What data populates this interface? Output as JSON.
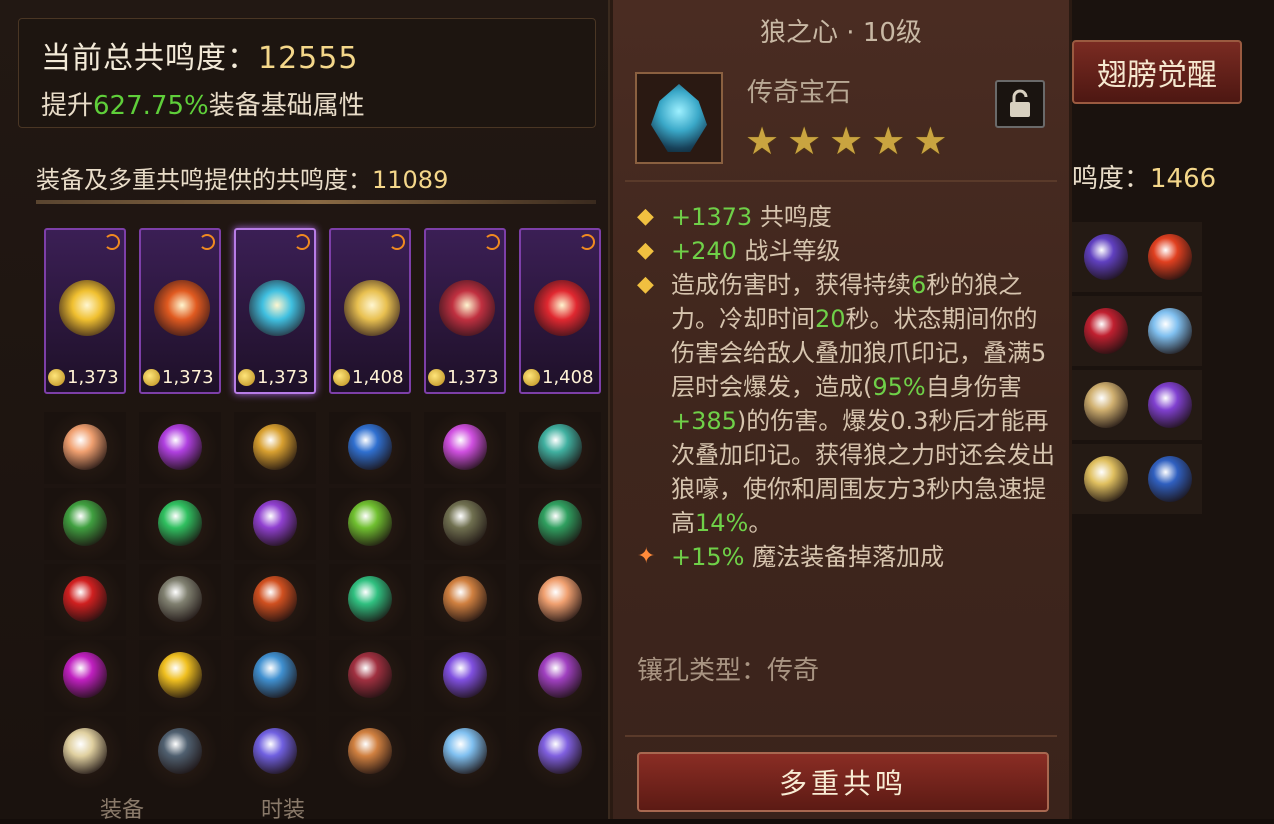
{
  "summary": {
    "total_label": "当前总共鸣度：",
    "total_value": "12555",
    "boost_prefix": "提升",
    "boost_pct": "627.75%",
    "boost_suffix": "装备基础属性"
  },
  "equip_section": {
    "label": "装备及多重共鸣提供的共鸣度：",
    "value": "11089"
  },
  "equip_slots": [
    {
      "value": "1,373",
      "color": "#f0c030"
    },
    {
      "value": "1,373",
      "color": "#e05a20"
    },
    {
      "value": "1,373",
      "color": "#40c0e0"
    },
    {
      "value": "1,408",
      "color": "#e8c050"
    },
    {
      "value": "1,373",
      "color": "#c03040"
    },
    {
      "value": "1,408",
      "color": "#e02830"
    }
  ],
  "gem_colors": [
    [
      "#f0a070",
      "#b040e0",
      "#d8a030",
      "#3070d0",
      "#d050e0",
      "#40b0a0"
    ],
    [
      "#40a040",
      "#30c060",
      "#9040d0",
      "#70c030",
      "#707050",
      "#30a060"
    ],
    [
      "#d02020",
      "#808070",
      "#d05020",
      "#30c080",
      "#d08040",
      "#f0a070"
    ],
    [
      "#c020c0",
      "#f0c020",
      "#4090d0",
      "#a03040",
      "#8050e0",
      "#a040c0"
    ],
    [
      "#e0d0a0",
      "#506070",
      "#7060e0",
      "#d08040",
      "#80c0f0",
      "#8060e0"
    ]
  ],
  "bottom_tabs": [
    "装备",
    "时装"
  ],
  "right_panel": {
    "wings_label": "翅膀觉醒",
    "score_label": "鸣度：",
    "score_value": "1466",
    "gem_colors": [
      [
        "#6040c0",
        "#e04020"
      ],
      [
        "#c02030",
        "#80c0f0"
      ],
      [
        "#d0b070",
        "#8040d0"
      ],
      [
        "#e0c060",
        "#3060c0"
      ]
    ]
  },
  "tooltip": {
    "title": "狼之心 · 10级",
    "type_label": "传奇宝石",
    "stars": 5,
    "lock_icon": "unlock-icon",
    "stats": [
      {
        "plus": "+1373",
        "label": " 共鸣度"
      },
      {
        "plus": "+240",
        "label": " 战斗等级"
      }
    ],
    "effect": {
      "t1": "造成伤害时，获得持续",
      "v1": "6",
      "t2": "秒的狼之力。冷却时间",
      "v2": "20",
      "t3": "秒。状态期间你的伤害会给敌人叠加狼爪印记，叠满5层时会爆发，造成(",
      "v3": "95%",
      "t4": "自身伤害",
      "v4": "+385",
      "t5": ")的伤害。爆发0.3秒后才能再次叠加印记。获得狼之力时还会发出狼嚎，使你和周围友方3秒内急速提高",
      "v5": "14%",
      "t6": "。"
    },
    "bonus": {
      "plus": "+15%",
      "label": " 魔法装备掉落加成"
    },
    "socket_label": "镶孔类型：传奇",
    "button_label": "多重共鸣"
  }
}
